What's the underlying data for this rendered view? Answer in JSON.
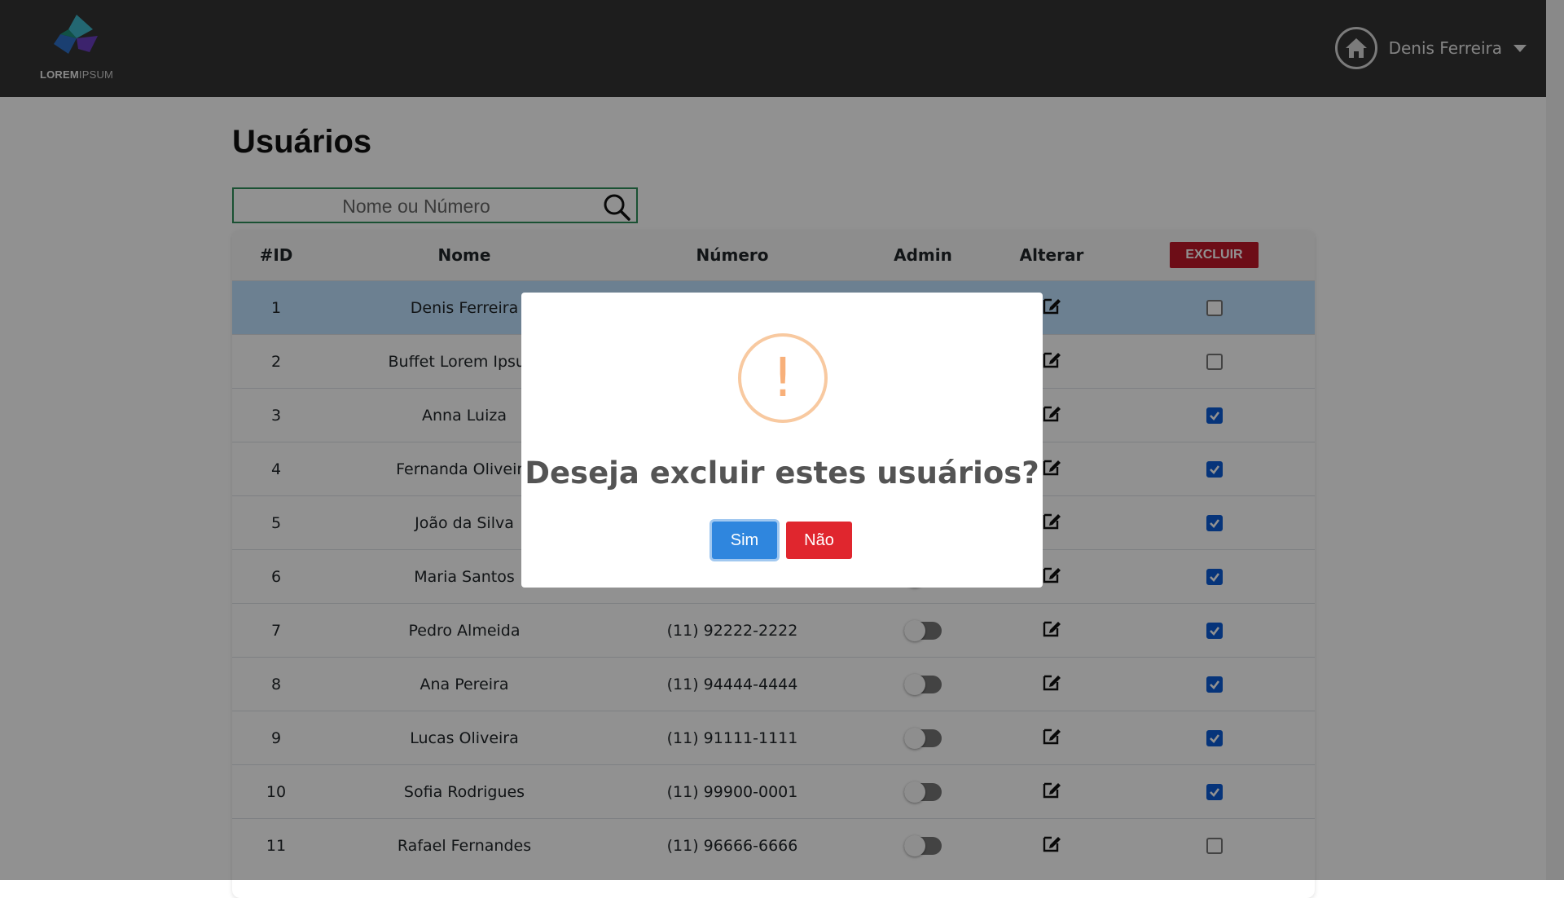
{
  "header": {
    "logo": {
      "word1": "LOREM",
      "word2": "IPSUM"
    },
    "user_name": "Denis Ferreira"
  },
  "page": {
    "title": "Usuários"
  },
  "search": {
    "placeholder": "Nome ou Número",
    "value": ""
  },
  "table": {
    "headers": {
      "id": "#ID",
      "nome": "Nome",
      "numero": "Número",
      "admin": "Admin",
      "alterar": "Alterar",
      "excluir": "EXCLUIR"
    },
    "rows": [
      {
        "id": "1",
        "nome": "Denis Ferreira",
        "numero": "",
        "admin": true,
        "excluir": false
      },
      {
        "id": "2",
        "nome": "Buffet Lorem Ipsum",
        "numero": "",
        "admin": false,
        "excluir": false
      },
      {
        "id": "3",
        "nome": "Anna Luiza",
        "numero": "",
        "admin": false,
        "excluir": true
      },
      {
        "id": "4",
        "nome": "Fernanda Oliveira",
        "numero": "",
        "admin": false,
        "excluir": true
      },
      {
        "id": "5",
        "nome": "João da Silva",
        "numero": "",
        "admin": false,
        "excluir": true
      },
      {
        "id": "6",
        "nome": "Maria Santos",
        "numero": "",
        "admin": false,
        "excluir": true
      },
      {
        "id": "7",
        "nome": "Pedro Almeida",
        "numero": "(11) 92222-2222",
        "admin": false,
        "excluir": true
      },
      {
        "id": "8",
        "nome": "Ana Pereira",
        "numero": "(11) 94444-4444",
        "admin": false,
        "excluir": true
      },
      {
        "id": "9",
        "nome": "Lucas Oliveira",
        "numero": "(11) 91111-1111",
        "admin": false,
        "excluir": true
      },
      {
        "id": "10",
        "nome": "Sofia Rodrigues",
        "numero": "(11) 99900-0001",
        "admin": false,
        "excluir": true
      },
      {
        "id": "11",
        "nome": "Rafael Fernandes",
        "numero": "(11) 96666-6666",
        "admin": false,
        "excluir": false
      }
    ]
  },
  "modal": {
    "icon": "exclamation-icon",
    "symbol": "!",
    "title": "Deseja excluir estes usuários?",
    "confirm_label": "Sim",
    "cancel_label": "Não"
  },
  "colors": {
    "header_bg": "#333333",
    "excluir": "#c0172a",
    "confirm": "#2f86de",
    "cancel": "#e0262e",
    "warning": "#f8b07a",
    "checkbox_on": "#0b5cd6"
  }
}
